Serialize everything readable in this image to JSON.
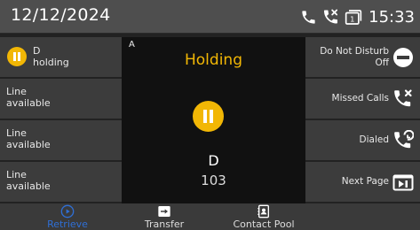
{
  "status_bar": {
    "date": "12/12/2024",
    "time": "15:33",
    "voicemail_count": "1",
    "icons": [
      "phone-icon",
      "missed-call-icon",
      "voicemail-icon"
    ]
  },
  "line_keys": [
    {
      "line1": "D",
      "line2": "holding",
      "state": "holding"
    },
    {
      "line1": "Line",
      "line2": "available",
      "state": "available"
    },
    {
      "line1": "Line",
      "line2": "available",
      "state": "available"
    },
    {
      "line1": "Line",
      "line2": "available",
      "state": "available"
    }
  ],
  "call": {
    "account_label": "A",
    "status": "Holding",
    "contact_name": "D",
    "contact_number": "103"
  },
  "function_keys": [
    {
      "line1": "Do Not Disturb",
      "line2": "Off",
      "icon": "do-not-disturb-icon"
    },
    {
      "line1": "Missed Calls",
      "icon": "missed-calls-icon"
    },
    {
      "line1": "Dialed",
      "icon": "dialed-icon"
    },
    {
      "line1": "Next Page",
      "icon": "next-page-icon"
    }
  ],
  "softkeys": [
    {
      "label": "Retrieve",
      "icon": "play-circle-icon",
      "selected": true
    },
    {
      "label": "Transfer",
      "icon": "transfer-icon",
      "selected": false
    },
    {
      "label": "Contact Pool",
      "icon": "contacts-icon",
      "selected": false
    }
  ],
  "colors": {
    "hold_accent": "#f2b705",
    "selected_softkey": "#2f6fd6",
    "status_bar": "#4e4e4e",
    "key_background": "#3c3c3c"
  }
}
